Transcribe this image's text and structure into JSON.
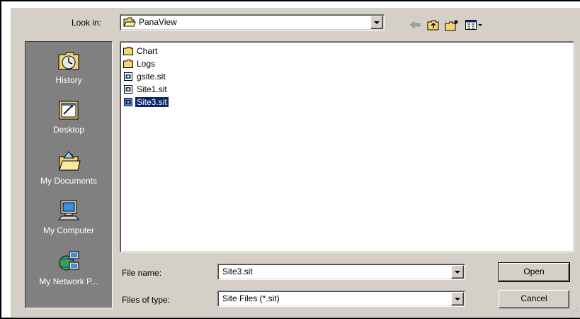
{
  "look_in": {
    "label": "Look in:",
    "value": "PanaView",
    "folder_icon": "open-folder-icon"
  },
  "toolbar": {
    "icons": [
      "back-arrow-icon",
      "up-one-level-icon",
      "new-folder-icon",
      "view-menu-icon"
    ]
  },
  "places_bar": {
    "items": [
      {
        "label": "History",
        "icon": "history-icon"
      },
      {
        "label": "Desktop",
        "icon": "desktop-icon"
      },
      {
        "label": "My Documents",
        "icon": "my-documents-icon"
      },
      {
        "label": "My Computer",
        "icon": "my-computer-icon"
      },
      {
        "label": "My Network P...",
        "icon": "network-places-icon"
      }
    ]
  },
  "file_list": {
    "items": [
      {
        "name": "Chart",
        "type": "folder",
        "selected": false
      },
      {
        "name": "Logs",
        "type": "folder",
        "selected": false
      },
      {
        "name": "gsite.sit",
        "type": "file",
        "selected": false
      },
      {
        "name": "Site1.sit",
        "type": "file",
        "selected": false
      },
      {
        "name": "Site3.sit",
        "type": "file",
        "selected": true
      }
    ]
  },
  "file_name": {
    "label": "File name:",
    "value": "Site3.sit"
  },
  "files_of_type": {
    "label": "Files of type:",
    "value": "Site Files (*.sit)"
  },
  "buttons": {
    "open": "Open",
    "cancel": "Cancel"
  },
  "colors": {
    "dialog_bg": "#d4d0c8",
    "places_bg": "#808080",
    "selection": "#0a246a"
  }
}
